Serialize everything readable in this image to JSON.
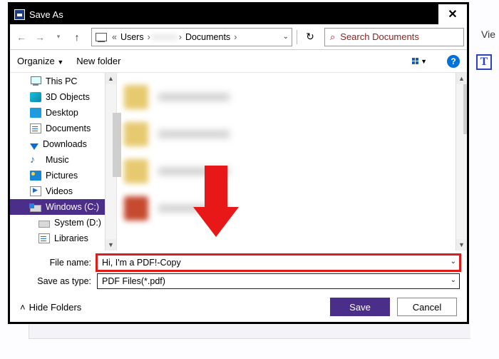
{
  "window": {
    "title": "Save As"
  },
  "nav": {
    "path": [
      "Users",
      "",
      "Documents"
    ],
    "search_placeholder": "Search Documents"
  },
  "toolbar": {
    "organize": "Organize",
    "newfolder": "New folder"
  },
  "sidebar": {
    "items": [
      {
        "label": "This PC",
        "icon": "pc"
      },
      {
        "label": "3D Objects",
        "icon": "cube"
      },
      {
        "label": "Desktop",
        "icon": "desk"
      },
      {
        "label": "Documents",
        "icon": "doc"
      },
      {
        "label": "Downloads",
        "icon": "dl"
      },
      {
        "label": "Music",
        "icon": "music"
      },
      {
        "label": "Pictures",
        "icon": "pic"
      },
      {
        "label": "Videos",
        "icon": "vid"
      },
      {
        "label": "Windows (C:)",
        "icon": "drive win",
        "selected": true
      },
      {
        "label": "System (D:)",
        "icon": "drive",
        "sub": true
      },
      {
        "label": "Libraries",
        "icon": "doc",
        "sub": true
      }
    ]
  },
  "fields": {
    "filename_label": "File name:",
    "filename_value": "Hi, I'm a PDF!-Copy",
    "type_label": "Save as type:",
    "type_value": "PDF Files(*.pdf)"
  },
  "footer": {
    "hidefolders": "Hide Folders",
    "save": "Save",
    "cancel": "Cancel"
  },
  "right": {
    "view": "Vie",
    "t": "T"
  }
}
